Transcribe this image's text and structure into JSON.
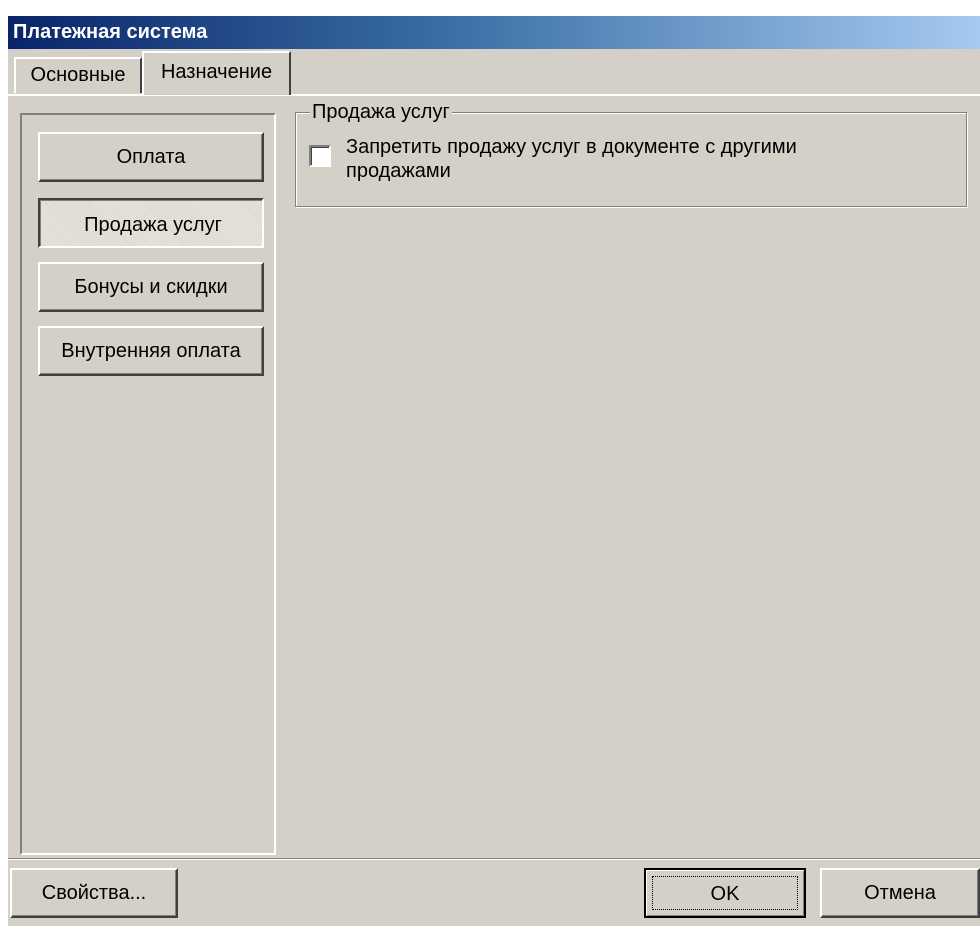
{
  "window": {
    "title": "Платежная система"
  },
  "tabs": [
    {
      "label": "Основные",
      "active": false
    },
    {
      "label": "Назначение",
      "active": true
    }
  ],
  "nav_buttons": [
    {
      "label": "Оплата",
      "pressed": false
    },
    {
      "label": "Продажа услуг",
      "pressed": true
    },
    {
      "label": "Бонусы и скидки",
      "pressed": false
    },
    {
      "label": "Внутренняя оплата",
      "pressed": false
    }
  ],
  "group": {
    "legend": "Продажа услуг",
    "checkbox": {
      "label": "Запретить продажу услуг в документе с другими продажами",
      "checked": false
    }
  },
  "footer": {
    "properties_label": "Свойства...",
    "ok_label": "OK",
    "cancel_label": "Отмена"
  },
  "colors": {
    "face": "#d4d0c8",
    "title_start": "#0a246a",
    "title_end": "#a6caf0"
  }
}
